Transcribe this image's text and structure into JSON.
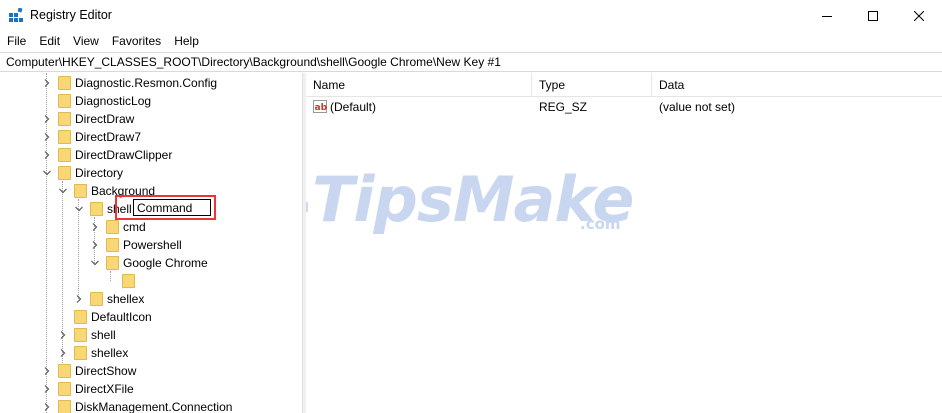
{
  "window": {
    "title": "Registry Editor",
    "icon": "registry-editor-icon",
    "controls": {
      "minimize": "minimize-icon",
      "maximize": "maximize-icon",
      "close": "close-icon"
    }
  },
  "menu": {
    "items": [
      "File",
      "Edit",
      "View",
      "Favorites",
      "Help"
    ]
  },
  "address": {
    "path": "Computer\\HKEY_CLASSES_ROOT\\Directory\\Background\\shell\\Google Chrome\\New Key #1"
  },
  "tree": {
    "items": [
      {
        "label": "Diagnostic.Resmon.Config",
        "level": 0,
        "expander": "collapsed"
      },
      {
        "label": "DiagnosticLog",
        "level": 0,
        "expander": "none"
      },
      {
        "label": "DirectDraw",
        "level": 0,
        "expander": "collapsed"
      },
      {
        "label": "DirectDraw7",
        "level": 0,
        "expander": "collapsed"
      },
      {
        "label": "DirectDrawClipper",
        "level": 0,
        "expander": "collapsed"
      },
      {
        "label": "Directory",
        "level": 0,
        "expander": "expanded"
      },
      {
        "label": "Background",
        "level": 1,
        "expander": "expanded"
      },
      {
        "label": "shell",
        "level": 2,
        "expander": "expanded"
      },
      {
        "label": "cmd",
        "level": 3,
        "expander": "collapsed"
      },
      {
        "label": "Powershell",
        "level": 3,
        "expander": "collapsed"
      },
      {
        "label": "Google Chrome",
        "level": 3,
        "expander": "expanded"
      },
      {
        "label": "",
        "level": 4,
        "expander": "none"
      },
      {
        "label": "shellex",
        "level": 2,
        "expander": "collapsed"
      },
      {
        "label": "DefaultIcon",
        "level": 1,
        "expander": "none"
      },
      {
        "label": "shell",
        "level": 1,
        "expander": "collapsed"
      },
      {
        "label": "shellex",
        "level": 1,
        "expander": "collapsed"
      },
      {
        "label": "DirectShow",
        "level": 0,
        "expander": "collapsed"
      },
      {
        "label": "DirectXFile",
        "level": 0,
        "expander": "collapsed"
      },
      {
        "label": "DiskManagement.Connection",
        "level": 0,
        "expander": "collapsed"
      }
    ],
    "rename": {
      "value": "Command"
    },
    "colors": {
      "folder": "#f8d775",
      "folder_border": "#e3b94d",
      "highlight": "#e8363a"
    }
  },
  "list": {
    "columns": [
      "Name",
      "Type",
      "Data"
    ],
    "rows": [
      {
        "name": "(Default)",
        "type": "REG_SZ",
        "data": "(value not set)",
        "icon": "string-value-icon"
      }
    ]
  },
  "watermark": {
    "text": "TipsMake",
    "suffix": ".com"
  }
}
